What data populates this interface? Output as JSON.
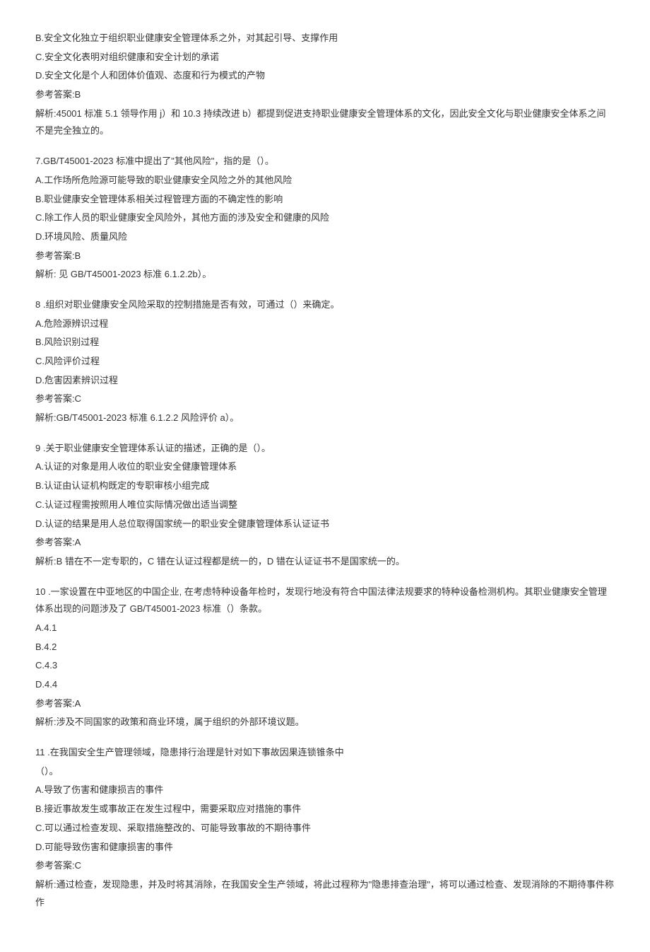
{
  "q6_tail": {
    "optB": "B.安全文化独立于组织职业健康安全管理体系之外，对其起引导、支撑作用",
    "optC": "C.安全文化表明对组织健康和安全计划的承诺",
    "optD": "D.安全文化是个人和团体价值观、态度和行为模式的产物",
    "ans": "参考答案:B",
    "exp": "解析:45001 标准 5.1 领导作用 j）和 10.3 持续改进 b）都提到促进支持职业健康安全管理体系的文化，因此安全文化与职业健康安全体系之间不是完全独立的。"
  },
  "q7": {
    "stem": "7.GB/T45001-2023 标准中提出了\"其他风险\"，指的是（）。",
    "optA": "A.工作场所危险源可能导致的职业健康安全风险之外的其他风险",
    "optB": "B.职业健康安全管理体系相关过程管理方面的不确定性的影响",
    "optC": "C.除工作人员的职业健康安全风险外，其他方面的涉及安全和健康的风险",
    "optD": "D.环境风险、质量风险",
    "ans": "参考答案:B",
    "exp": "解析: 见 GB/T45001-2023 标准 6.1.2.2b）。"
  },
  "q8": {
    "stem": "8   .组织对职业健康安全风险采取的控制措施是否有效，可通过（）来确定。",
    "optA": "A.危险源辨识过程",
    "optB": "B.风险识别过程",
    "optC": "C.风险评价过程",
    "optD": "D.危害因素辨识过程",
    "ans": "参考答案:C",
    "exp": "解析:GB/T45001-2023 标准 6.1.2.2 风险评价 a）。"
  },
  "q9": {
    "stem": "9   .关于职业健康安全管理体系认证的描述，正确的是（）。",
    "optA": "A.认证的对象是用人收位的职业安全健康管理体系",
    "optB": "B.认证由认证机构既定的专职审核小组完成",
    "optC": "C.认证过程需按照用人唯位实际情况做出适当调整",
    "optD": "D.认证的结果是用人总位取得国家统一的职业安全健康管理体系认证证书",
    "ans": "参考答案:A",
    "exp": "解析:B 错在不一定专职的，C 错在认证过程都是统一的，D 错在认证证书不是国家统一的。"
  },
  "q10": {
    "stem": "10   .一家设置在中亚地区的中国企业, 在考虑特种设备年检时，发现行地没有符合中国法律法规要求的特种设备检测机构。其职业健康安全管理体系出现的问题涉及了 GB/T45001-2023 标准（）条款。",
    "optA": "A.4.1",
    "optB": "B.4.2",
    "optC": "C.4.3",
    "optD": "D.4.4",
    "ans": "参考答案:A",
    "exp": "解析:涉及不同国家的政策和商业环境，属于组织的外部环境议题。"
  },
  "q11": {
    "stem": "11   .在我国安全生产管理领域，隐患排行治理是针对如下事故因果连锁锥条中",
    "stem2": "（）。",
    "optA": "A.导致了伤害和健康损吉的事件",
    "optB": "B.接近事故发生或事故正在发生过程中，需要采取应对措施的事件",
    "optC": "C.可以通过检查发现、采取措施整改的、可能导致事故的不期待事件",
    "optD": "D.可能导致伤害和健康损害的事件",
    "ans": "参考答案:C",
    "exp": "解析:通过检查，发现隐患，并及时将其消除，在我国安全生产领域，将此过程称为\"隐患排查治理\"，将可以通过检查、发现消除的不期待事件称作"
  }
}
